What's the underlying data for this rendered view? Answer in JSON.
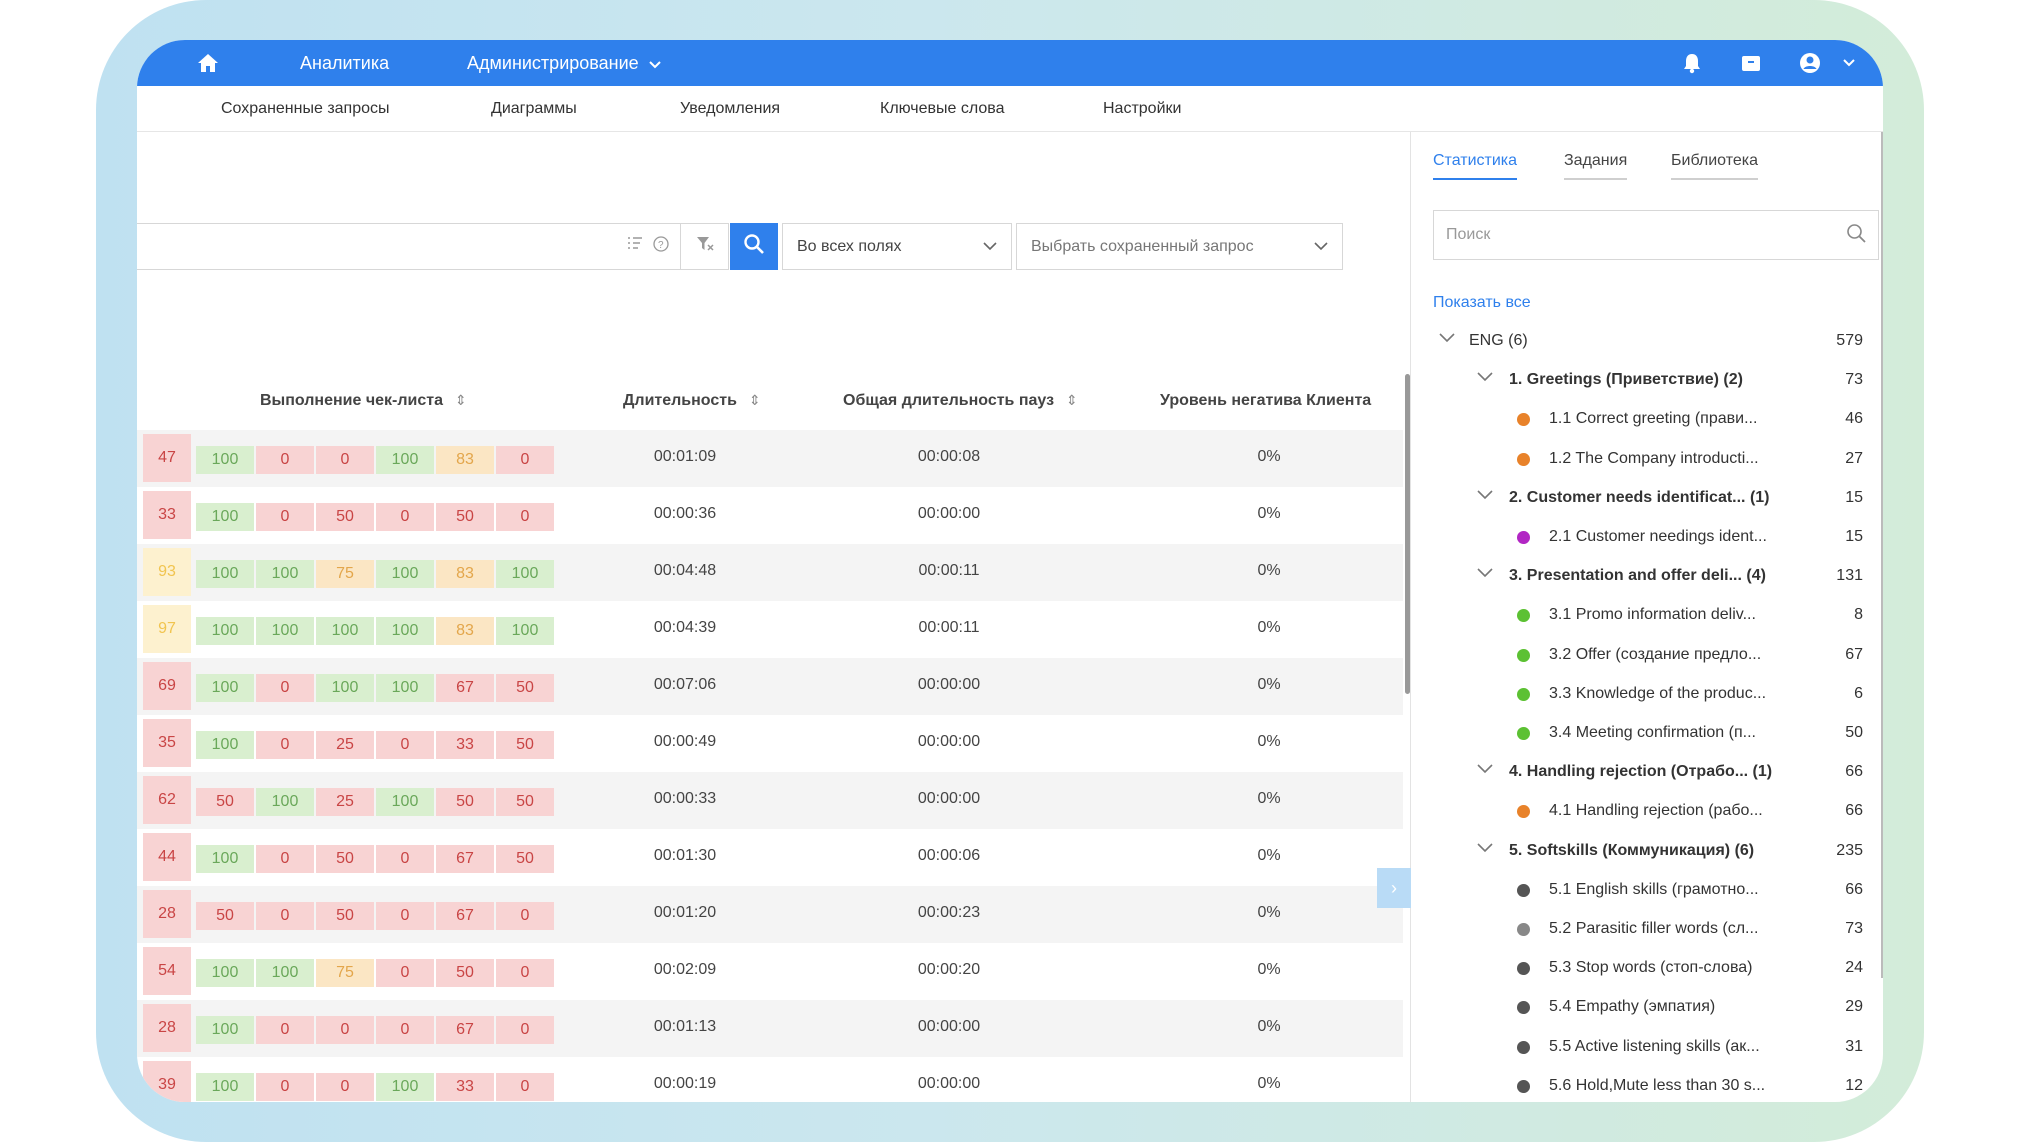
{
  "colors": {
    "accent": "#2f80ec",
    "red": "#c94545",
    "green": "#6aa85a",
    "yellow": "#e3a64b"
  },
  "topbar": {
    "home_icon": "home-icon",
    "analytics": "Аналитика",
    "admin": "Администрирование",
    "icons": [
      "bell-icon",
      "box-icon",
      "user-icon",
      "chevron-down-icon"
    ]
  },
  "submenu": [
    "Сохраненные запросы",
    "Диаграммы",
    "Уведомления",
    "Ключевые слова",
    "Настройки"
  ],
  "search": {
    "field_select": "Во всех полях",
    "saved_select_placeholder": "Выбрать сохраненный запрос"
  },
  "table": {
    "headers": [
      "Выполнение чек-листа",
      "Длительность",
      "Общая длительность пауз",
      "Уровень негатива Клиента"
    ],
    "rows": [
      {
        "score": "47",
        "score_color": "red",
        "chips": [
          [
            "100",
            "green"
          ],
          [
            "0",
            "red"
          ],
          [
            "0",
            "red"
          ],
          [
            "100",
            "green"
          ],
          [
            "83",
            "yellow"
          ],
          [
            "0",
            "red"
          ]
        ],
        "duration": "00:01:09",
        "pauses": "00:00:08",
        "negativity": "0%"
      },
      {
        "score": "33",
        "score_color": "red",
        "chips": [
          [
            "100",
            "green"
          ],
          [
            "0",
            "red"
          ],
          [
            "50",
            "red"
          ],
          [
            "0",
            "red"
          ],
          [
            "50",
            "red"
          ],
          [
            "0",
            "red"
          ]
        ],
        "duration": "00:00:36",
        "pauses": "00:00:00",
        "negativity": "0%"
      },
      {
        "score": "93",
        "score_color": "yellowbig",
        "chips": [
          [
            "100",
            "green"
          ],
          [
            "100",
            "green"
          ],
          [
            "75",
            "yellow"
          ],
          [
            "100",
            "green"
          ],
          [
            "83",
            "yellow"
          ],
          [
            "100",
            "green"
          ]
        ],
        "duration": "00:04:48",
        "pauses": "00:00:11",
        "negativity": "0%"
      },
      {
        "score": "97",
        "score_color": "yellowbig",
        "chips": [
          [
            "100",
            "green"
          ],
          [
            "100",
            "green"
          ],
          [
            "100",
            "green"
          ],
          [
            "100",
            "green"
          ],
          [
            "83",
            "yellow"
          ],
          [
            "100",
            "green"
          ]
        ],
        "duration": "00:04:39",
        "pauses": "00:00:11",
        "negativity": "0%"
      },
      {
        "score": "69",
        "score_color": "red",
        "chips": [
          [
            "100",
            "green"
          ],
          [
            "0",
            "red"
          ],
          [
            "100",
            "green"
          ],
          [
            "100",
            "green"
          ],
          [
            "67",
            "red"
          ],
          [
            "50",
            "red"
          ]
        ],
        "duration": "00:07:06",
        "pauses": "00:00:00",
        "negativity": "0%"
      },
      {
        "score": "35",
        "score_color": "red",
        "chips": [
          [
            "100",
            "green"
          ],
          [
            "0",
            "red"
          ],
          [
            "25",
            "red"
          ],
          [
            "0",
            "red"
          ],
          [
            "33",
            "red"
          ],
          [
            "50",
            "red"
          ]
        ],
        "duration": "00:00:49",
        "pauses": "00:00:00",
        "negativity": "0%"
      },
      {
        "score": "62",
        "score_color": "red",
        "chips": [
          [
            "50",
            "red"
          ],
          [
            "100",
            "green"
          ],
          [
            "25",
            "red"
          ],
          [
            "100",
            "green"
          ],
          [
            "50",
            "red"
          ],
          [
            "50",
            "red"
          ]
        ],
        "duration": "00:00:33",
        "pauses": "00:00:00",
        "negativity": "0%"
      },
      {
        "score": "44",
        "score_color": "red",
        "chips": [
          [
            "100",
            "green"
          ],
          [
            "0",
            "red"
          ],
          [
            "50",
            "red"
          ],
          [
            "0",
            "red"
          ],
          [
            "67",
            "red"
          ],
          [
            "50",
            "red"
          ]
        ],
        "duration": "00:01:30",
        "pauses": "00:00:06",
        "negativity": "0%"
      },
      {
        "score": "28",
        "score_color": "red",
        "chips": [
          [
            "50",
            "red"
          ],
          [
            "0",
            "red"
          ],
          [
            "50",
            "red"
          ],
          [
            "0",
            "red"
          ],
          [
            "67",
            "red"
          ],
          [
            "0",
            "red"
          ]
        ],
        "duration": "00:01:20",
        "pauses": "00:00:23",
        "negativity": "0%"
      },
      {
        "score": "54",
        "score_color": "red",
        "chips": [
          [
            "100",
            "green"
          ],
          [
            "100",
            "green"
          ],
          [
            "75",
            "yellow"
          ],
          [
            "0",
            "red"
          ],
          [
            "50",
            "red"
          ],
          [
            "0",
            "red"
          ]
        ],
        "duration": "00:02:09",
        "pauses": "00:00:20",
        "negativity": "0%"
      },
      {
        "score": "28",
        "score_color": "red",
        "chips": [
          [
            "100",
            "green"
          ],
          [
            "0",
            "red"
          ],
          [
            "0",
            "red"
          ],
          [
            "0",
            "red"
          ],
          [
            "67",
            "red"
          ],
          [
            "0",
            "red"
          ]
        ],
        "duration": "00:01:13",
        "pauses": "00:00:00",
        "negativity": "0%"
      },
      {
        "score": "39",
        "score_color": "red",
        "chips": [
          [
            "100",
            "green"
          ],
          [
            "0",
            "red"
          ],
          [
            "0",
            "red"
          ],
          [
            "100",
            "green"
          ],
          [
            "33",
            "red"
          ],
          [
            "0",
            "red"
          ]
        ],
        "duration": "00:00:19",
        "pauses": "00:00:00",
        "negativity": "0%"
      }
    ]
  },
  "panel": {
    "tabs": [
      "Статистика",
      "Задания",
      "Библиотека"
    ],
    "search_placeholder": "Поиск",
    "show_all": "Показать все",
    "tree": [
      {
        "level": 0,
        "label": "ENG (6)",
        "count": "579",
        "bold": false,
        "chevron": true
      },
      {
        "level": 1,
        "label": "1. Greetings (Приветствие) (2)",
        "count": "73",
        "bold": true,
        "chevron": true
      },
      {
        "level": 2,
        "label": "1.1 Correct greeting (прави...",
        "count": "46",
        "dot": "#e8822a"
      },
      {
        "level": 2,
        "label": "1.2 The Company introducti...",
        "count": "27",
        "dot": "#e8822a"
      },
      {
        "level": 1,
        "label": "2. Customer needs identificat... (1)",
        "count": "15",
        "bold": true,
        "chevron": true
      },
      {
        "level": 2,
        "label": "2.1 Customer needings ident...",
        "count": "15",
        "dot": "#b226c4"
      },
      {
        "level": 1,
        "label": "3. Presentation and offer deli... (4)",
        "count": "131",
        "bold": true,
        "chevron": true
      },
      {
        "level": 2,
        "label": "3.1 Promo information deliv...",
        "count": "8",
        "dot": "#5cc133"
      },
      {
        "level": 2,
        "label": "3.2 Offer (создание предло...",
        "count": "67",
        "dot": "#5cc133"
      },
      {
        "level": 2,
        "label": "3.3 Knowledge of the produc...",
        "count": "6",
        "dot": "#5cc133"
      },
      {
        "level": 2,
        "label": "3.4 Meeting confirmation (п...",
        "count": "50",
        "dot": "#5cc133"
      },
      {
        "level": 1,
        "label": "4. Handling rejection (Отрабо... (1)",
        "count": "66",
        "bold": true,
        "chevron": true
      },
      {
        "level": 2,
        "label": "4.1 Handling rejection (рабо...",
        "count": "66",
        "dot": "#e8822a"
      },
      {
        "level": 1,
        "label": "5. Softskills (Коммуникация) (6)",
        "count": "235",
        "bold": true,
        "chevron": true
      },
      {
        "level": 2,
        "label": "5.1 English skills (грамотно...",
        "count": "66",
        "dot": "#555555"
      },
      {
        "level": 2,
        "label": "5.2 Parasitic filler words (сл...",
        "count": "73",
        "dot": "#888888"
      },
      {
        "level": 2,
        "label": "5.3 Stop words (стоп-слова)",
        "count": "24",
        "dot": "#555555"
      },
      {
        "level": 2,
        "label": "5.4 Empathy (эмпатия)",
        "count": "29",
        "dot": "#555555"
      },
      {
        "level": 2,
        "label": "5.5 Active listening skills (ак...",
        "count": "31",
        "dot": "#555555"
      },
      {
        "level": 2,
        "label": "5.6 Hold,Mute less than 30 s...",
        "count": "12",
        "dot": "#555555"
      }
    ]
  }
}
